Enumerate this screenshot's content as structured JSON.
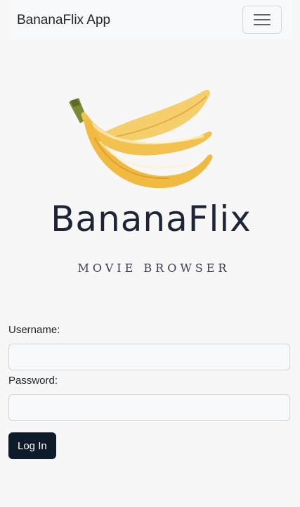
{
  "navbar": {
    "brand": "BananaFlix App",
    "toggler_icon": "hamburger-menu-icon"
  },
  "logo": {
    "title": "BananaFlix",
    "subtitle": "MOVIE BROWSER",
    "image": "banana-bunch-icon",
    "colors": {
      "banana": "#f2c14e",
      "banana_shadow": "#d9962a",
      "stem": "#7a8a3a",
      "text": "#1d2436"
    }
  },
  "form": {
    "username_label": "Username:",
    "username_value": "",
    "password_label": "Password:",
    "password_value": "",
    "submit_label": "Log In"
  },
  "colors": {
    "background": "#f7f7f8",
    "button": "#0d1b2a"
  }
}
